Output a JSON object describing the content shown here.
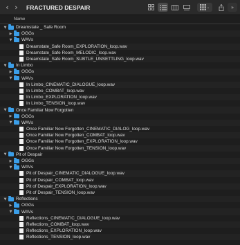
{
  "window": {
    "title": "FRACTURED DESPAIR"
  },
  "toolbar": {
    "back_icon": "chevron-left-icon",
    "forward_icon": "chevron-right-icon",
    "views": [
      "grid-view-icon",
      "list-view-icon",
      "column-view-icon",
      "gallery-view-icon"
    ],
    "active_view": "list-view-icon"
  },
  "columns": {
    "name": "Name"
  },
  "colors": {
    "folder": "#3b9ee8",
    "file": "#f2f2f2",
    "background": "#1e1e1e"
  },
  "rows": [
    {
      "level": 0,
      "type": "folder",
      "expanded": true,
      "label": "Dreamstate _ Safe Room"
    },
    {
      "level": 1,
      "type": "folder",
      "expanded": false,
      "label": "OGGs"
    },
    {
      "level": 1,
      "type": "folder",
      "expanded": true,
      "label": "WAVs"
    },
    {
      "level": 2,
      "type": "file",
      "label": "Dreamstate_Safe Room_EXPLORATION_loop.wav"
    },
    {
      "level": 2,
      "type": "file",
      "label": "Dreamstate_Safe Room_MELODIC_loop.wav"
    },
    {
      "level": 2,
      "type": "file",
      "label": "Dreamstate_Safe Room_SUBTLE_UNSETTLING_loop.wav"
    },
    {
      "level": 0,
      "type": "folder",
      "expanded": true,
      "label": "In Limbo"
    },
    {
      "level": 1,
      "type": "folder",
      "expanded": false,
      "label": "OGGs"
    },
    {
      "level": 1,
      "type": "folder",
      "expanded": true,
      "label": "WAVs"
    },
    {
      "level": 2,
      "type": "file",
      "label": "In Limbo_CINEMATIC_DIALOGUE_loop.wav"
    },
    {
      "level": 2,
      "type": "file",
      "label": "In Limbo_COMBAT_loop.wav"
    },
    {
      "level": 2,
      "type": "file",
      "label": "In Limbo_EXPLORATION_loop.wav"
    },
    {
      "level": 2,
      "type": "file",
      "label": "In Limbo_TENSION_loop.wav"
    },
    {
      "level": 0,
      "type": "folder",
      "expanded": true,
      "label": "Once Familiar Now Forgotten"
    },
    {
      "level": 1,
      "type": "folder",
      "expanded": false,
      "label": "OGGs"
    },
    {
      "level": 1,
      "type": "folder",
      "expanded": true,
      "label": "WAVs"
    },
    {
      "level": 2,
      "type": "file",
      "label": "Once Familiar Now Forgotten_CINEMATIC_DIALOG_loop.wav"
    },
    {
      "level": 2,
      "type": "file",
      "label": "Once Familiar Now Forgotten_COMBAT_loop.wav"
    },
    {
      "level": 2,
      "type": "file",
      "label": "Once Familiar Now Forgotten_EXPLORATION_loop.wav"
    },
    {
      "level": 2,
      "type": "file",
      "label": "Once Familiar Now Forgotten_TENSION_loop.wav"
    },
    {
      "level": 0,
      "type": "folder",
      "expanded": true,
      "label": "Pit of Despair"
    },
    {
      "level": 1,
      "type": "folder",
      "expanded": false,
      "label": "OGGs"
    },
    {
      "level": 1,
      "type": "folder",
      "expanded": true,
      "label": "WAVs"
    },
    {
      "level": 2,
      "type": "file",
      "label": "Pit of Despair_CINEMATIC_DIALOGUE_loop.wav"
    },
    {
      "level": 2,
      "type": "file",
      "label": "Pit of Despair_COMBAT_loop.wav"
    },
    {
      "level": 2,
      "type": "file",
      "label": "Pit of Despair_EXPLORATION_loop.wav"
    },
    {
      "level": 2,
      "type": "file",
      "label": "Pit of Despair_TENSION_loop.wav"
    },
    {
      "level": 0,
      "type": "folder",
      "expanded": true,
      "label": "Reflections"
    },
    {
      "level": 1,
      "type": "folder",
      "expanded": false,
      "label": "OGGs"
    },
    {
      "level": 1,
      "type": "folder",
      "expanded": true,
      "label": "WAVs"
    },
    {
      "level": 2,
      "type": "file",
      "label": "Reflections_CINEMATIC_DIALOGUE_loop.wav"
    },
    {
      "level": 2,
      "type": "file",
      "label": "Reflections_COMBAT_loop.wav"
    },
    {
      "level": 2,
      "type": "file",
      "label": "Reflections_EXPLORATION_loop.wav"
    },
    {
      "level": 2,
      "type": "file",
      "label": "Reflections_TENSION_loop.wav"
    }
  ]
}
